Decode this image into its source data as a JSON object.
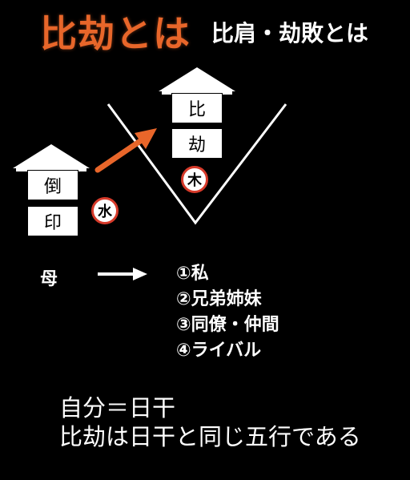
{
  "header": {
    "title": "比劫とは",
    "subtitle": "比肩・劫敗とは"
  },
  "left_house": {
    "top": "倒",
    "bottom": "印",
    "element": "水"
  },
  "right_house": {
    "top": "比",
    "bottom": "劫",
    "element": "木"
  },
  "mother_label": "母",
  "list": [
    "①私",
    "②兄弟姉妹",
    "③同僚・仲間",
    "④ライバル"
  ],
  "bottom": {
    "line1": "自分＝日干",
    "line2": "比劫は日干と同じ五行である"
  },
  "colors": {
    "title": "#e8662a",
    "arrow": "#e8662a",
    "circle_border": "#d63a2a"
  }
}
